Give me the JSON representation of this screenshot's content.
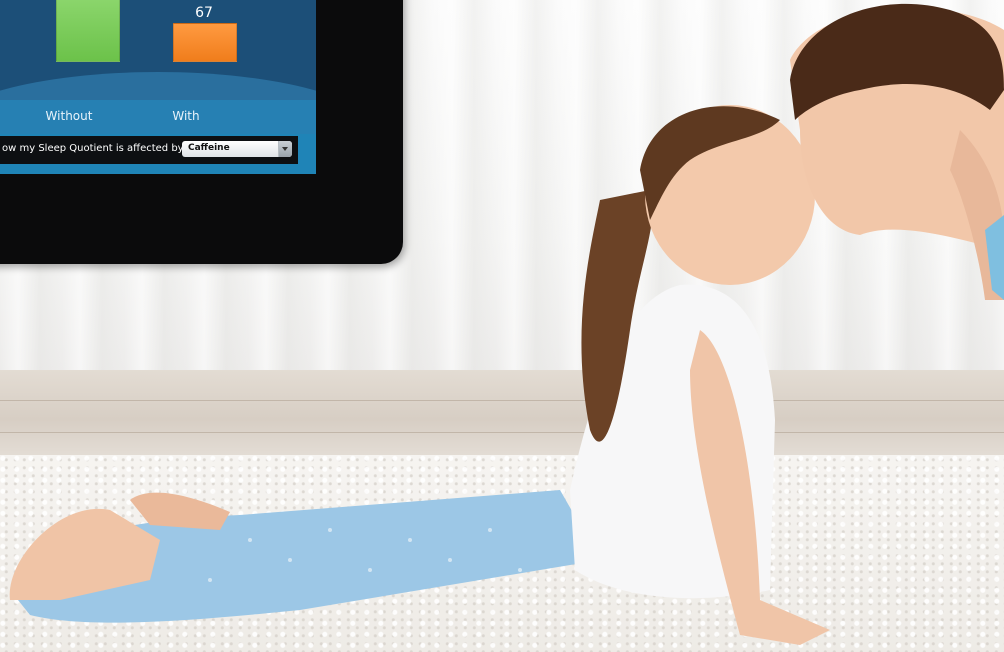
{
  "tablet_screen": {
    "chart_data": {
      "type": "bar",
      "categories": [
        "Without",
        "With"
      ],
      "values": [
        null,
        67
      ],
      "value_labels": [
        "",
        "67"
      ],
      "colors": [
        "#6cc24a",
        "#f07d1c"
      ]
    },
    "control": {
      "label": "ow my Sleep Quotient is affected by:",
      "selected": "Caffeine"
    }
  },
  "colors": {
    "screen_blue": "#1f84b7",
    "chart_background": "#1c4f78",
    "bar_without": "#6cc24a",
    "bar_with": "#f07d1c"
  }
}
